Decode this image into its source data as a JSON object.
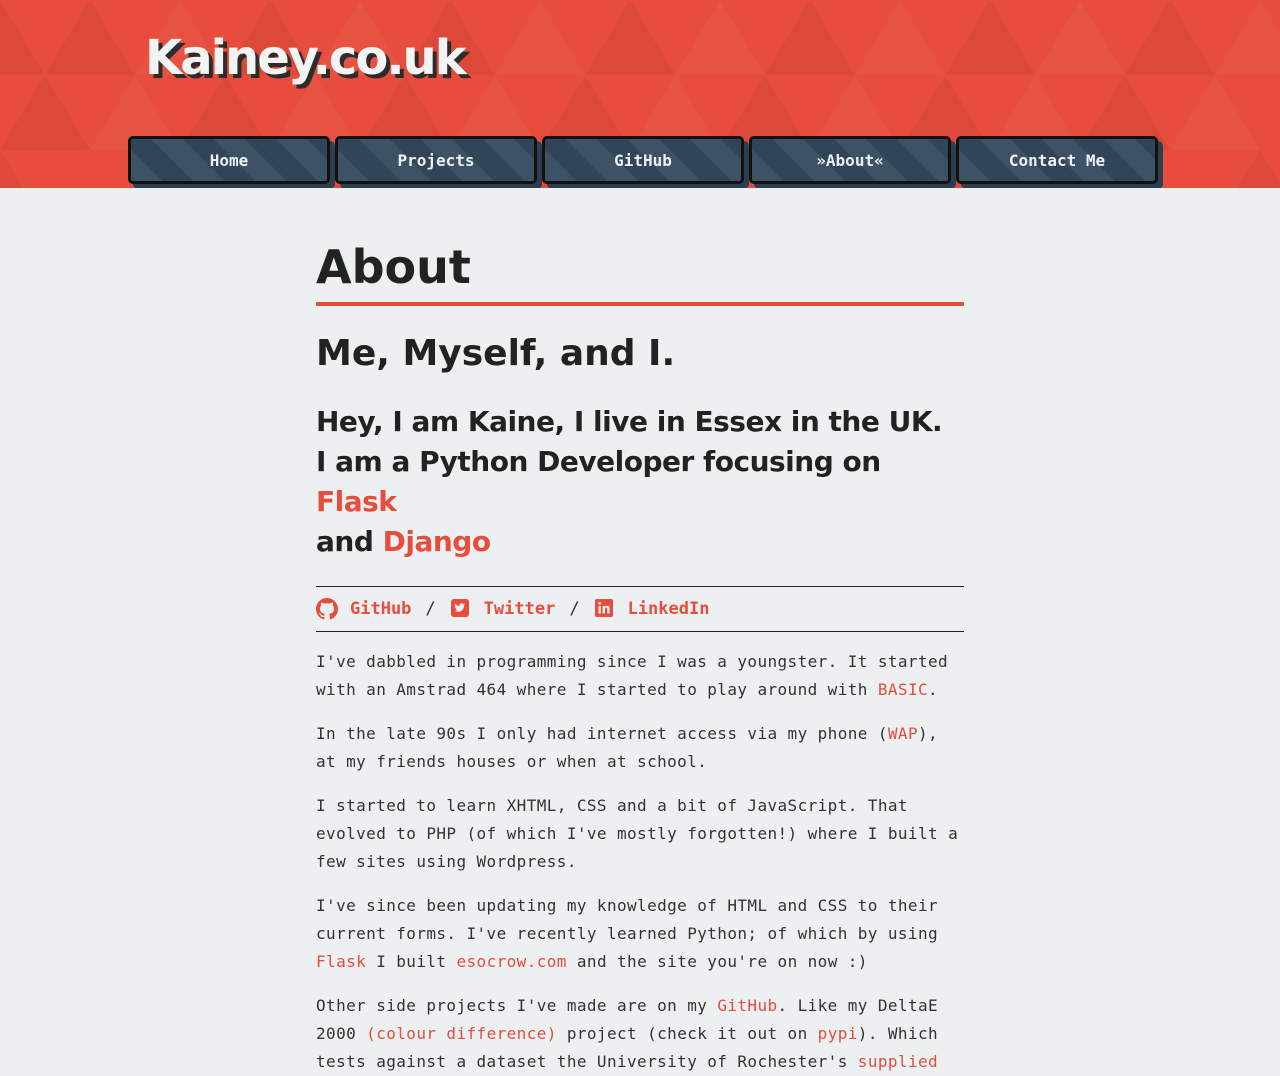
{
  "header": {
    "logo": "Kainey.co.uk"
  },
  "nav": {
    "items": [
      "Home",
      "Projects",
      "GitHub",
      "»About«",
      "Contact Me"
    ]
  },
  "main": {
    "title": "About",
    "subtitle": "Me, Myself, and I.",
    "intro": {
      "line1": "Hey, I am Kaine, I live in Essex in the UK.",
      "line2": "I am a Python Developer focusing on",
      "flask": "Flask",
      "and": "and",
      "django": "Django"
    },
    "social": {
      "github": "GitHub",
      "twitter": "Twitter",
      "linkedin": "LinkedIn",
      "separator": "/"
    },
    "paragraphs": {
      "p1_a": "I've dabbled in programming since I was a youngster. It started with an Amstrad 464 where I started to play around with ",
      "p1_link": "BASIC",
      "p1_b": ".",
      "p2_a": "In the late 90s I only had internet access via my phone (",
      "p2_link": "WAP",
      "p2_b": "), at my friends houses or when at school.",
      "p3": "I started to learn XHTML, CSS and a bit of JavaScript. That evolved to PHP (of which I've mostly forgotten!) where I built a few sites using Wordpress.",
      "p4_a": "I've since been updating my knowledge of HTML and CSS to their current forms. I've recently learned Python; of which by using ",
      "p4_link1": "Flask",
      "p4_b": " I built ",
      "p4_link2": "esocrow.com",
      "p4_c": " and the site you're on now :)",
      "p5_a": "Other side projects I've made are on my ",
      "p5_link1": "GitHub",
      "p5_b": ". Like my DeltaE 2000 ",
      "p5_link2": "(colour difference)",
      "p5_c": " project (check it out on ",
      "p5_link3": "pypi",
      "p5_d": "). Which tests against a dataset the University of Rochester's ",
      "p5_link4": "supplied"
    }
  },
  "icons": {
    "github": "github-icon",
    "twitter": "twitter-icon",
    "linkedin": "linkedin-icon"
  },
  "colors": {
    "accent": "#e74c3c",
    "nav_bg": "#34495e",
    "page_bg": "#ecf0f1"
  }
}
